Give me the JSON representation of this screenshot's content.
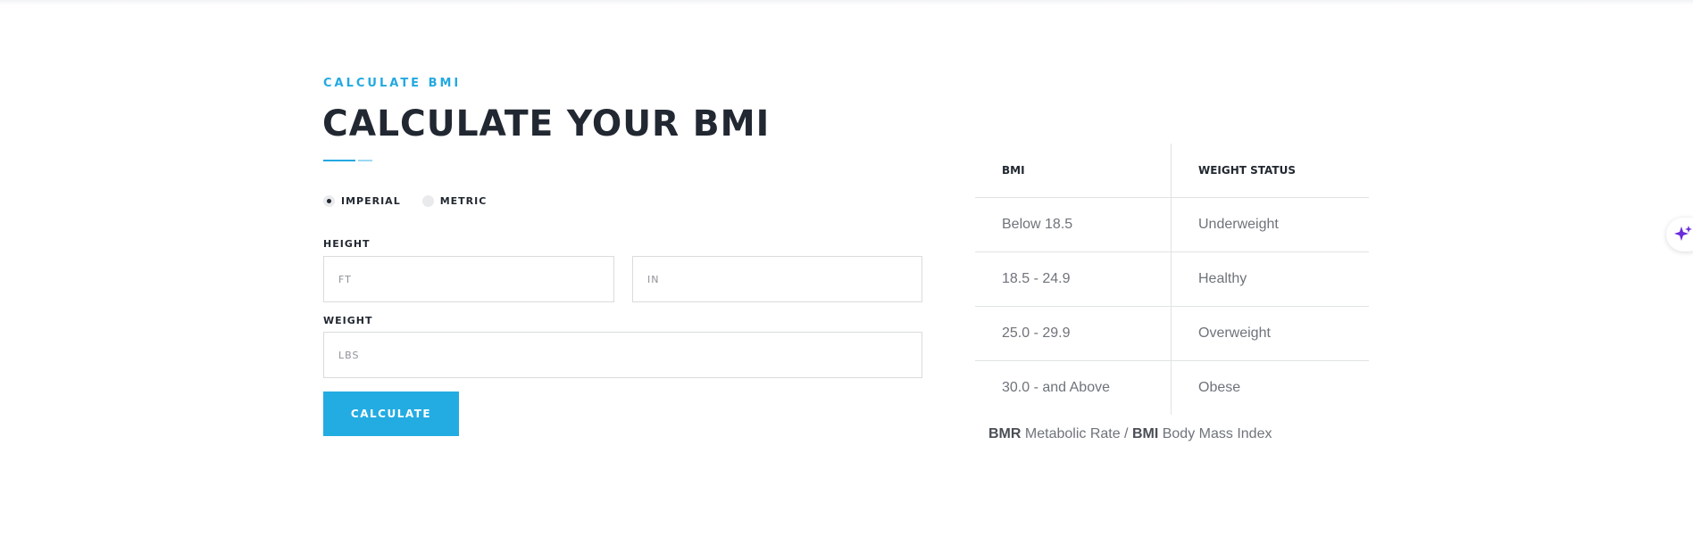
{
  "section": {
    "eyebrow": "CALCULATE BMI",
    "title": "CALCULATE YOUR BMI"
  },
  "units": {
    "options": [
      {
        "label": "IMPERIAL",
        "checked": true
      },
      {
        "label": "METRIC",
        "checked": false
      }
    ]
  },
  "form": {
    "height_label": "HEIGHT",
    "height_ft_placeholder": "FT",
    "height_in_placeholder": "IN",
    "weight_label": "WEIGHT",
    "weight_placeholder": "LBS",
    "calculate_label": "CALCULATE"
  },
  "table": {
    "headers": [
      "BMI",
      "WEIGHT STATUS"
    ],
    "rows": [
      [
        "Below 18.5",
        "Underweight"
      ],
      [
        "18.5 - 24.9",
        "Healthy"
      ],
      [
        "25.0 - 29.9",
        "Overweight"
      ],
      [
        "30.0 - and Above",
        "Obese"
      ]
    ]
  },
  "legend": {
    "bmr_abbr": "BMR",
    "bmr_text": "Metabolic Rate /",
    "bmi_abbr": "BMI",
    "bmi_text": "Body Mass Index"
  },
  "widgets": {
    "ai_icon": "sparkle-icon"
  },
  "colors": {
    "accent": "#23a9e1",
    "heading": "#222831",
    "body_text": "#6f737a",
    "ai_icon": "#6a2bd9"
  }
}
